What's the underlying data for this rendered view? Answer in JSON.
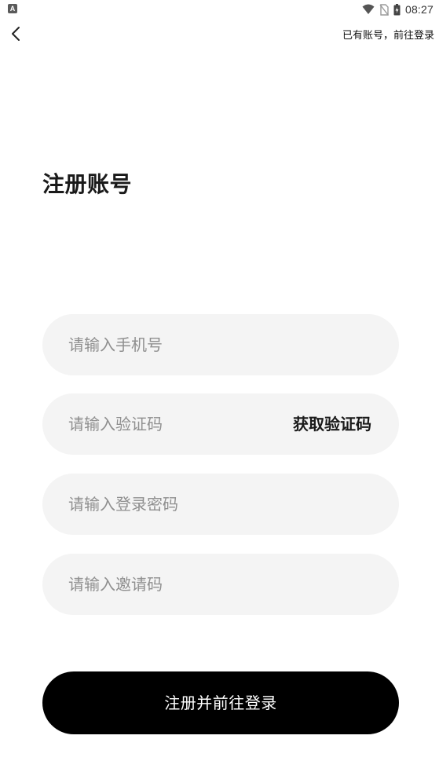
{
  "status_bar": {
    "app_icon_letter": "A",
    "time": "08:27",
    "icons": [
      "wifi-icon",
      "no-sim-icon",
      "battery-icon"
    ]
  },
  "nav": {
    "back_icon": "chevron-left-icon",
    "login_link": "已有账号，前往登录"
  },
  "title": "注册账号",
  "form": {
    "phone": {
      "value": "",
      "placeholder": "请输入手机号"
    },
    "code": {
      "value": "",
      "placeholder": "请输入验证码",
      "get_code_label": "获取验证码"
    },
    "password": {
      "value": "",
      "placeholder": "请输入登录密码"
    },
    "invite": {
      "value": "",
      "placeholder": "请输入邀请码"
    }
  },
  "submit_label": "注册并前往登录",
  "colors": {
    "background": "#ffffff",
    "field_background": "#f4f4f4",
    "placeholder": "#8f8f8f",
    "primary_button": "#000000",
    "primary_button_text": "#ffffff"
  }
}
